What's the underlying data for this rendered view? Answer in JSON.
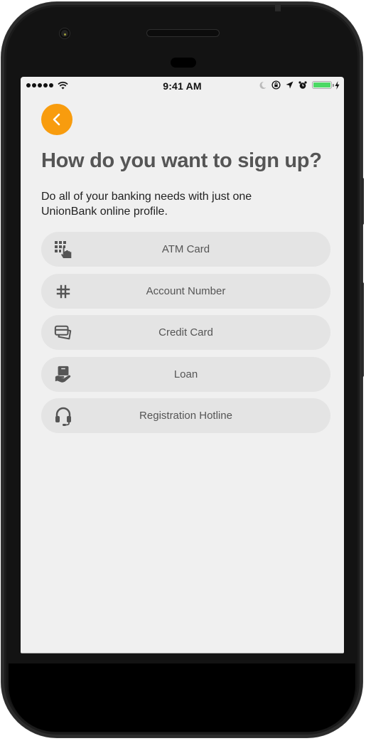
{
  "status_bar": {
    "signal_dots": 5,
    "time": "9:41 AM",
    "battery_level_percent": 100,
    "icons": [
      "signal-dots-icon",
      "wifi-icon",
      "moon-icon",
      "rotation-lock-icon",
      "location-arrow-icon",
      "alarm-icon",
      "battery-icon",
      "charging-bolt-icon"
    ]
  },
  "colors": {
    "accent": "#f89c0e",
    "title": "#555555",
    "option_background": "#e4e4e4",
    "screen_background": "#f0f0f0",
    "battery": "#4cd964"
  },
  "header": {
    "back_icon": "chevron-left-icon",
    "title": "How do you want to sign up?",
    "subtitle": "Do all of your banking needs with just one UnionBank online profile."
  },
  "options": [
    {
      "label": "ATM Card",
      "icon": "keypad-hand-icon"
    },
    {
      "label": "Account Number",
      "icon": "hash-icon"
    },
    {
      "label": "Credit Card",
      "icon": "credit-card-icon"
    },
    {
      "label": "Loan",
      "icon": "loan-hand-icon"
    },
    {
      "label": "Registration Hotline",
      "icon": "headset-icon"
    }
  ]
}
